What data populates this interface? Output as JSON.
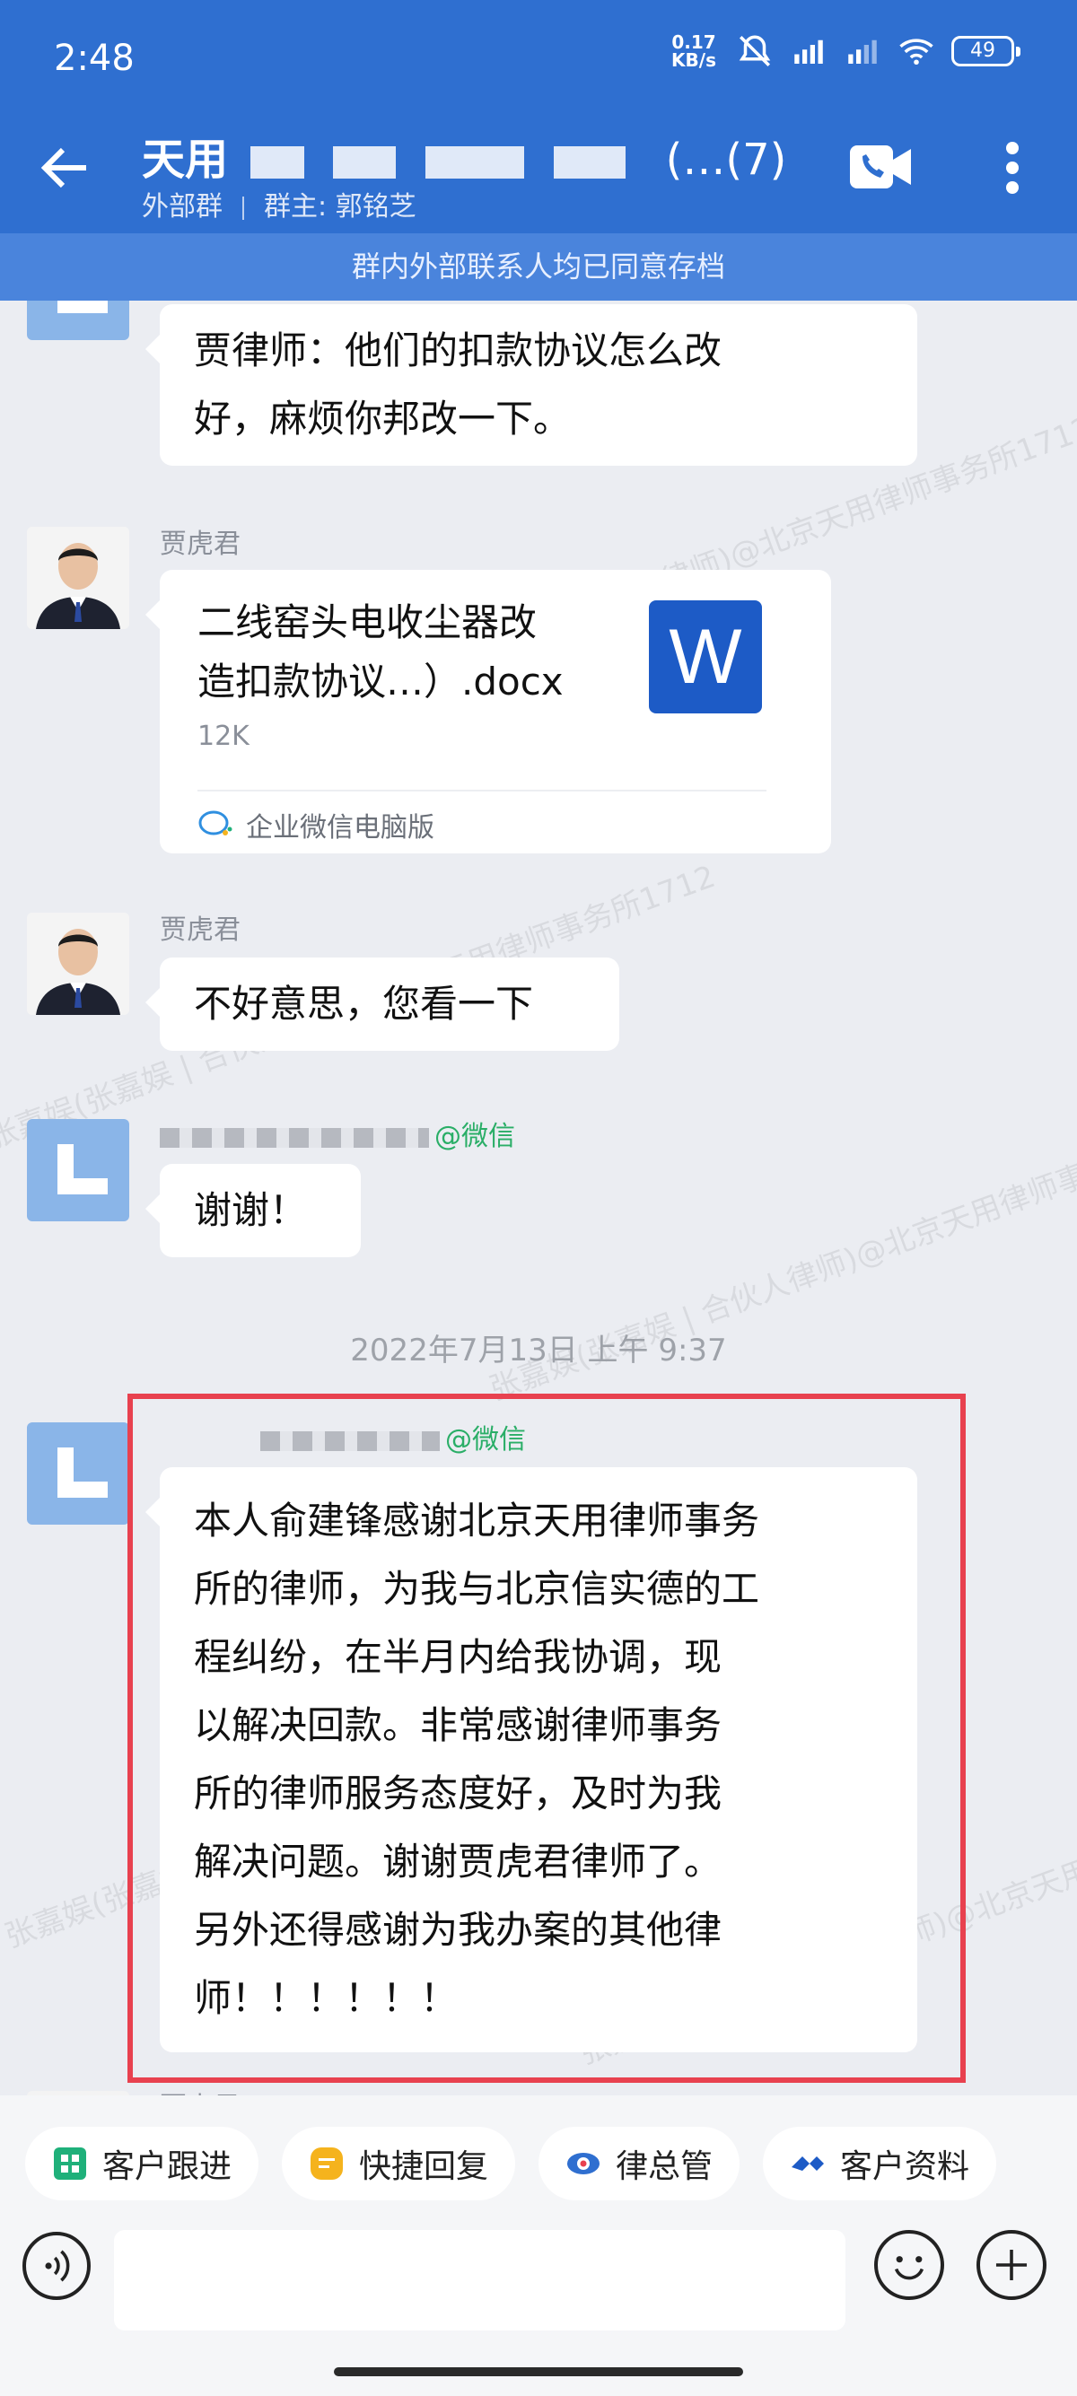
{
  "status_bar": {
    "time": "2:48",
    "net_speed_value": "0.17",
    "net_speed_unit": "KB/s",
    "battery": "49"
  },
  "header": {
    "title_prefix": "天用",
    "title_suffix": "(…(7)",
    "subtitle_left": "外部群",
    "subtitle_right": "群主: 郭铭芝",
    "archive_notice": "群内外部联系人均已同意存档",
    "icons": [
      "back-arrow-icon",
      "video-call-icon",
      "more-vert-icon"
    ]
  },
  "messages": [
    {
      "type": "text",
      "text_line1": "贾律师：他们的扣款协议怎么改",
      "text_line2": "好，麻烦你邦改一下。"
    },
    {
      "type": "file",
      "sender": "贾虎君",
      "file_name_line1": "二线窑头电收尘器改",
      "file_name_line2": "造扣款协议…）.docx",
      "file_size": "12K",
      "file_icon_letter": "W",
      "source": "企业微信电脑版"
    },
    {
      "type": "text",
      "sender": "贾虎君",
      "text": "不好意思，您看一下"
    },
    {
      "type": "text",
      "sender_tag": "@微信",
      "text": "谢谢！"
    },
    {
      "type": "timestamp",
      "text": "2022年7月13日  上午 9:37"
    },
    {
      "type": "text",
      "sender_tag": "@微信",
      "lines": [
        "本人俞建锋感谢北京天用律师事务",
        "所的律师，为我与北京信实德的工",
        "程纠纷，在半月内给我协调，现",
        "以解决回款。非常感谢律师事务",
        "所的律师服务态度好，及时为我",
        "解决问题。谢谢贾虎君律师了。",
        "另外还得感谢为我办案的其他律",
        "师！！！！！！"
      ]
    }
  ],
  "partial_sender": "贾虎君",
  "watermark": "张嘉娱(张嘉娱 | 合伙人律师)@北京天用律师事务所1712",
  "quick_actions": [
    {
      "label": "客户跟进",
      "icon": "customer-follow-icon",
      "color": "#1fb07a"
    },
    {
      "label": "快捷回复",
      "icon": "quick-reply-icon",
      "color": "#f5b31d"
    },
    {
      "label": "律总管",
      "icon": "lawyer-manager-icon",
      "color": "#2f6fd0"
    },
    {
      "label": "客户资料",
      "icon": "customer-info-icon",
      "color": "#1d5bc6"
    }
  ],
  "input_bar": {
    "placeholder": "",
    "icons": [
      "voice-icon",
      "emoji-icon",
      "plus-icon"
    ]
  }
}
